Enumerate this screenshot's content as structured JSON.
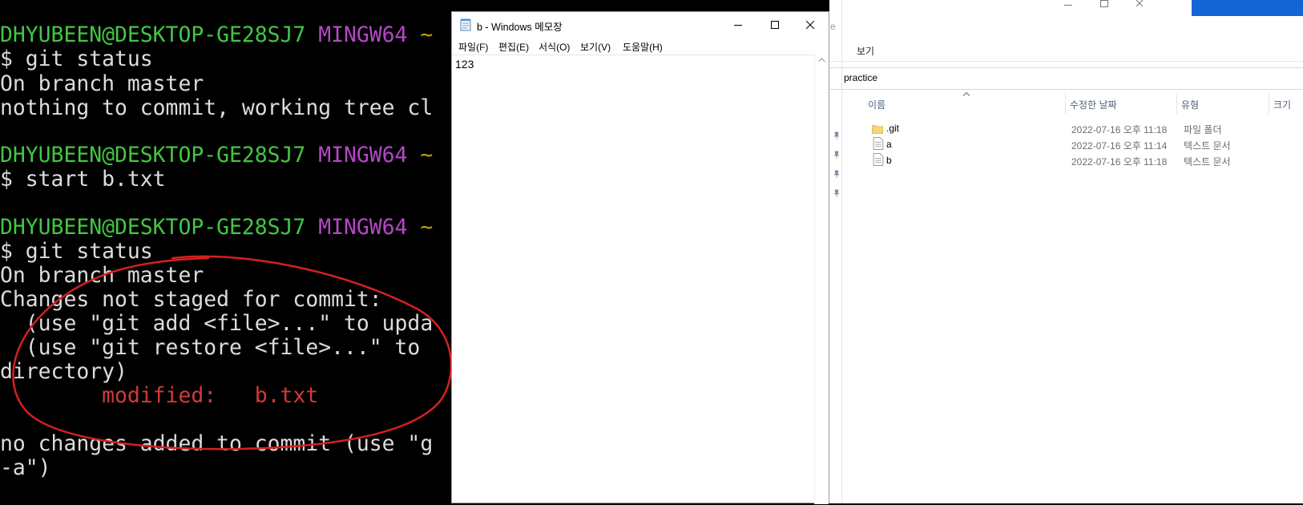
{
  "terminal": {
    "lines": [
      {
        "a": "DHYUBEEN@DESKTOP-GE28SJ7",
        "b": "MINGW64",
        "c": "~"
      },
      {
        "t": "$ git status"
      },
      {
        "t": "On branch master"
      },
      {
        "t": "nothing to commit, working tree cl"
      },
      {
        "a": "DHYUBEEN@DESKTOP-GE28SJ7",
        "b": "MINGW64",
        "c": "~"
      },
      {
        "t": "$ start b.txt"
      },
      {
        "a": "DHYUBEEN@DESKTOP-GE28SJ7",
        "b": "MINGW64",
        "c": "~"
      },
      {
        "t": "$ git status"
      },
      {
        "t": "On branch master"
      },
      {
        "t": "Changes not staged for commit:"
      },
      {
        "t": "  (use \"git add <file>...\" to upda"
      },
      {
        "t": "  (use \"git restore <file>...\" to "
      },
      {
        "t": "directory)"
      },
      {
        "mod_label": "modified:",
        "mod_file": "b.txt"
      },
      {
        "t": "no changes added to commit (use \"g"
      },
      {
        "t": "-a\")"
      }
    ],
    "annotation_color": "#d42020"
  },
  "notepad": {
    "title": "b - Windows 메모장",
    "menu": [
      "파일(F)",
      "편집(E)",
      "서식(O)",
      "보기(V)",
      "도움말(H)"
    ],
    "content": "123"
  },
  "explorer": {
    "partial_title": "e",
    "ribbon_tab": "보기",
    "address": "practice",
    "columns": [
      "이름",
      "수정한 날짜",
      "유형",
      "크기"
    ],
    "rows": [
      {
        "name": ".git",
        "date": "2022-07-16 오후 11:18",
        "type": "파일 폴더",
        "icon": "folder-icon"
      },
      {
        "name": "a",
        "date": "2022-07-16 오후 11:14",
        "type": "텍스트 문서",
        "icon": "text-file-icon"
      },
      {
        "name": "b",
        "date": "2022-07-16 오후 11:18",
        "type": "텍스트 문서",
        "icon": "text-file-icon"
      }
    ],
    "accent": "#1464d4"
  }
}
